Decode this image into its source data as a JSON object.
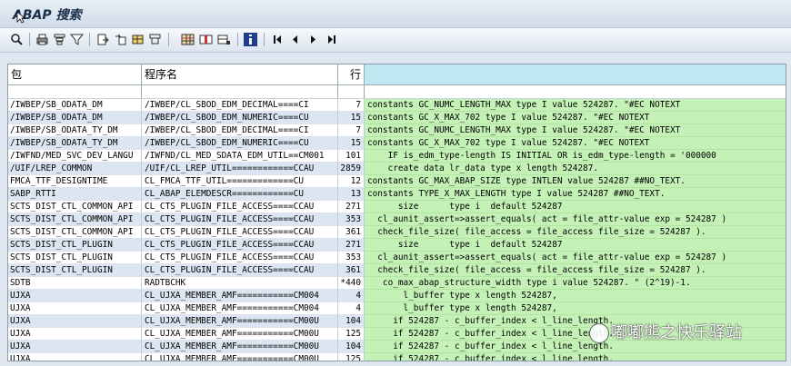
{
  "window": {
    "title": "ABAP 搜索"
  },
  "toolbar": {
    "icons": [
      "refresh-icon",
      "print-icon",
      "filter-icon",
      "filter-set-icon",
      "export-icon",
      "local-file-icon",
      "spreadsheet-icon",
      "layout-icon",
      "grid-icon",
      "column-icon",
      "sum-icon",
      "info-icon",
      "first-page-icon",
      "previous-page-icon",
      "next-page-icon",
      "last-page-icon"
    ]
  },
  "table": {
    "headers": {
      "package": "包",
      "program": "程序名",
      "line": "行",
      "code": ""
    },
    "rows": [
      {
        "package": "/IWBEP/SB_ODATA_DM",
        "program": "/IWBEP/CL_SBOD_EDM_DECIMAL====CI",
        "line": "7",
        "code": "constants GC_NUMC_LENGTH_MAX type I value 524287. \"#EC NOTEXT"
      },
      {
        "package": "/IWBEP/SB_ODATA_DM",
        "program": "/IWBEP/CL_SBOD_EDM_NUMERIC====CU",
        "line": "15",
        "code": "constants GC_X_MAX_702 type I value 524287. \"#EC NOTEXT"
      },
      {
        "package": "/IWBEP/SB_ODATA_TY_DM",
        "program": "/IWBEP/CL_SBOD_EDM_DECIMAL====CI",
        "line": "7",
        "code": "constants GC_NUMC_LENGTH_MAX type I value 524287. \"#EC NOTEXT"
      },
      {
        "package": "/IWBEP/SB_ODATA_TY_DM",
        "program": "/IWBEP/CL_SBOD_EDM_NUMERIC====CU",
        "line": "15",
        "code": "constants GC_X_MAX_702 type I value 524287. \"#EC NOTEXT"
      },
      {
        "package": "/IWFND/MED_SVC_DEV_LANGU",
        "program": "/IWFND/CL_MED_SDATA_EDM_UTIL==CM001",
        "line": "101",
        "code": "    IF is_edm_type-length IS INITIAL OR is_edm_type-length = '000000"
      },
      {
        "package": "/UIF/LREP_COMMON",
        "program": "/UIF/CL_LREP_UTIL============CCAU",
        "line": "2859",
        "code": "    create data lr_data type x length 524287."
      },
      {
        "package": "FMCA_TTF_DESIGNTIME",
        "program": "CL_FMCA_TTF_UTIL=============CU",
        "line": "12",
        "code": "constants GC_MAX_ABAP_SIZE type INTLEN value 524287 ##NO_TEXT."
      },
      {
        "package": "SABP_RTTI",
        "program": "CL_ABAP_ELEMDESCR============CU",
        "line": "13",
        "code": "constants TYPE_X_MAX_LENGTH type I value 524287 ##NO_TEXT."
      },
      {
        "package": "SCTS_DIST_CTL_COMMON_API",
        "program": "CL_CTS_PLUGIN_FILE_ACCESS====CCAU",
        "line": "271",
        "code": "      size      type i  default 524287"
      },
      {
        "package": "SCTS_DIST_CTL_COMMON_API",
        "program": "CL_CTS_PLUGIN_FILE_ACCESS====CCAU",
        "line": "353",
        "code": "  cl_aunit_assert=>assert_equals( act = file_attr-value exp = 524287 )"
      },
      {
        "package": "SCTS_DIST_CTL_COMMON_API",
        "program": "CL_CTS_PLUGIN_FILE_ACCESS====CCAU",
        "line": "361",
        "code": "  check_file_size( file_access = file_access file_size = 524287 )."
      },
      {
        "package": "SCTS_DIST_CTL_PLUGIN",
        "program": "CL_CTS_PLUGIN_FILE_ACCESS====CCAU",
        "line": "271",
        "code": "      size      type i  default 524287"
      },
      {
        "package": "SCTS_DIST_CTL_PLUGIN",
        "program": "CL_CTS_PLUGIN_FILE_ACCESS====CCAU",
        "line": "353",
        "code": "  cl_aunit_assert=>assert_equals( act = file_attr-value exp = 524287 )"
      },
      {
        "package": "SCTS_DIST_CTL_PLUGIN",
        "program": "CL_CTS_PLUGIN_FILE_ACCESS====CCAU",
        "line": "361",
        "code": "  check_file_size( file_access = file_access file_size = 524287 )."
      },
      {
        "package": "SDTB",
        "program": "RADTBCHK",
        "line": "*440",
        "code": "   co_max_abap_structure_width type i value 524287. \" (2^19)-1."
      },
      {
        "package": "UJXA",
        "program": "CL_UJXA_MEMBER_AMF===========CM004",
        "line": "4",
        "code": "       l_buffer type x length 524287,"
      },
      {
        "package": "UJXA",
        "program": "CL_UJXA_MEMBER_AMF===========CM004",
        "line": "4",
        "code": "       l_buffer type x length 524287,"
      },
      {
        "package": "UJXA",
        "program": "CL_UJXA_MEMBER_AMF===========CM00U",
        "line": "104",
        "code": "     if 524287 - c_buffer_index < l_line_length."
      },
      {
        "package": "UJXA",
        "program": "CL_UJXA_MEMBER_AMF===========CM00U",
        "line": "125",
        "code": "     if 524287 - c_buffer_index < l_line_length."
      },
      {
        "package": "UJXA",
        "program": "CL_UJXA_MEMBER_AMF===========CM00U",
        "line": "104",
        "code": "     if 524287 - c_buffer_index < l_line_length."
      },
      {
        "package": "UJXA",
        "program": "CL_UJXA_MEMBER_AMF===========CM00U",
        "line": "125",
        "code": "     if 524287 - c_buffer_index < l_line_length."
      }
    ]
  },
  "watermark": {
    "text": "嘟嘟熊之快乐驿站"
  },
  "colors": {
    "code_bg": "#c4f1b6",
    "header_code_bg": "#bfe7f2",
    "row_alt_bg": "#dbe6f2"
  }
}
